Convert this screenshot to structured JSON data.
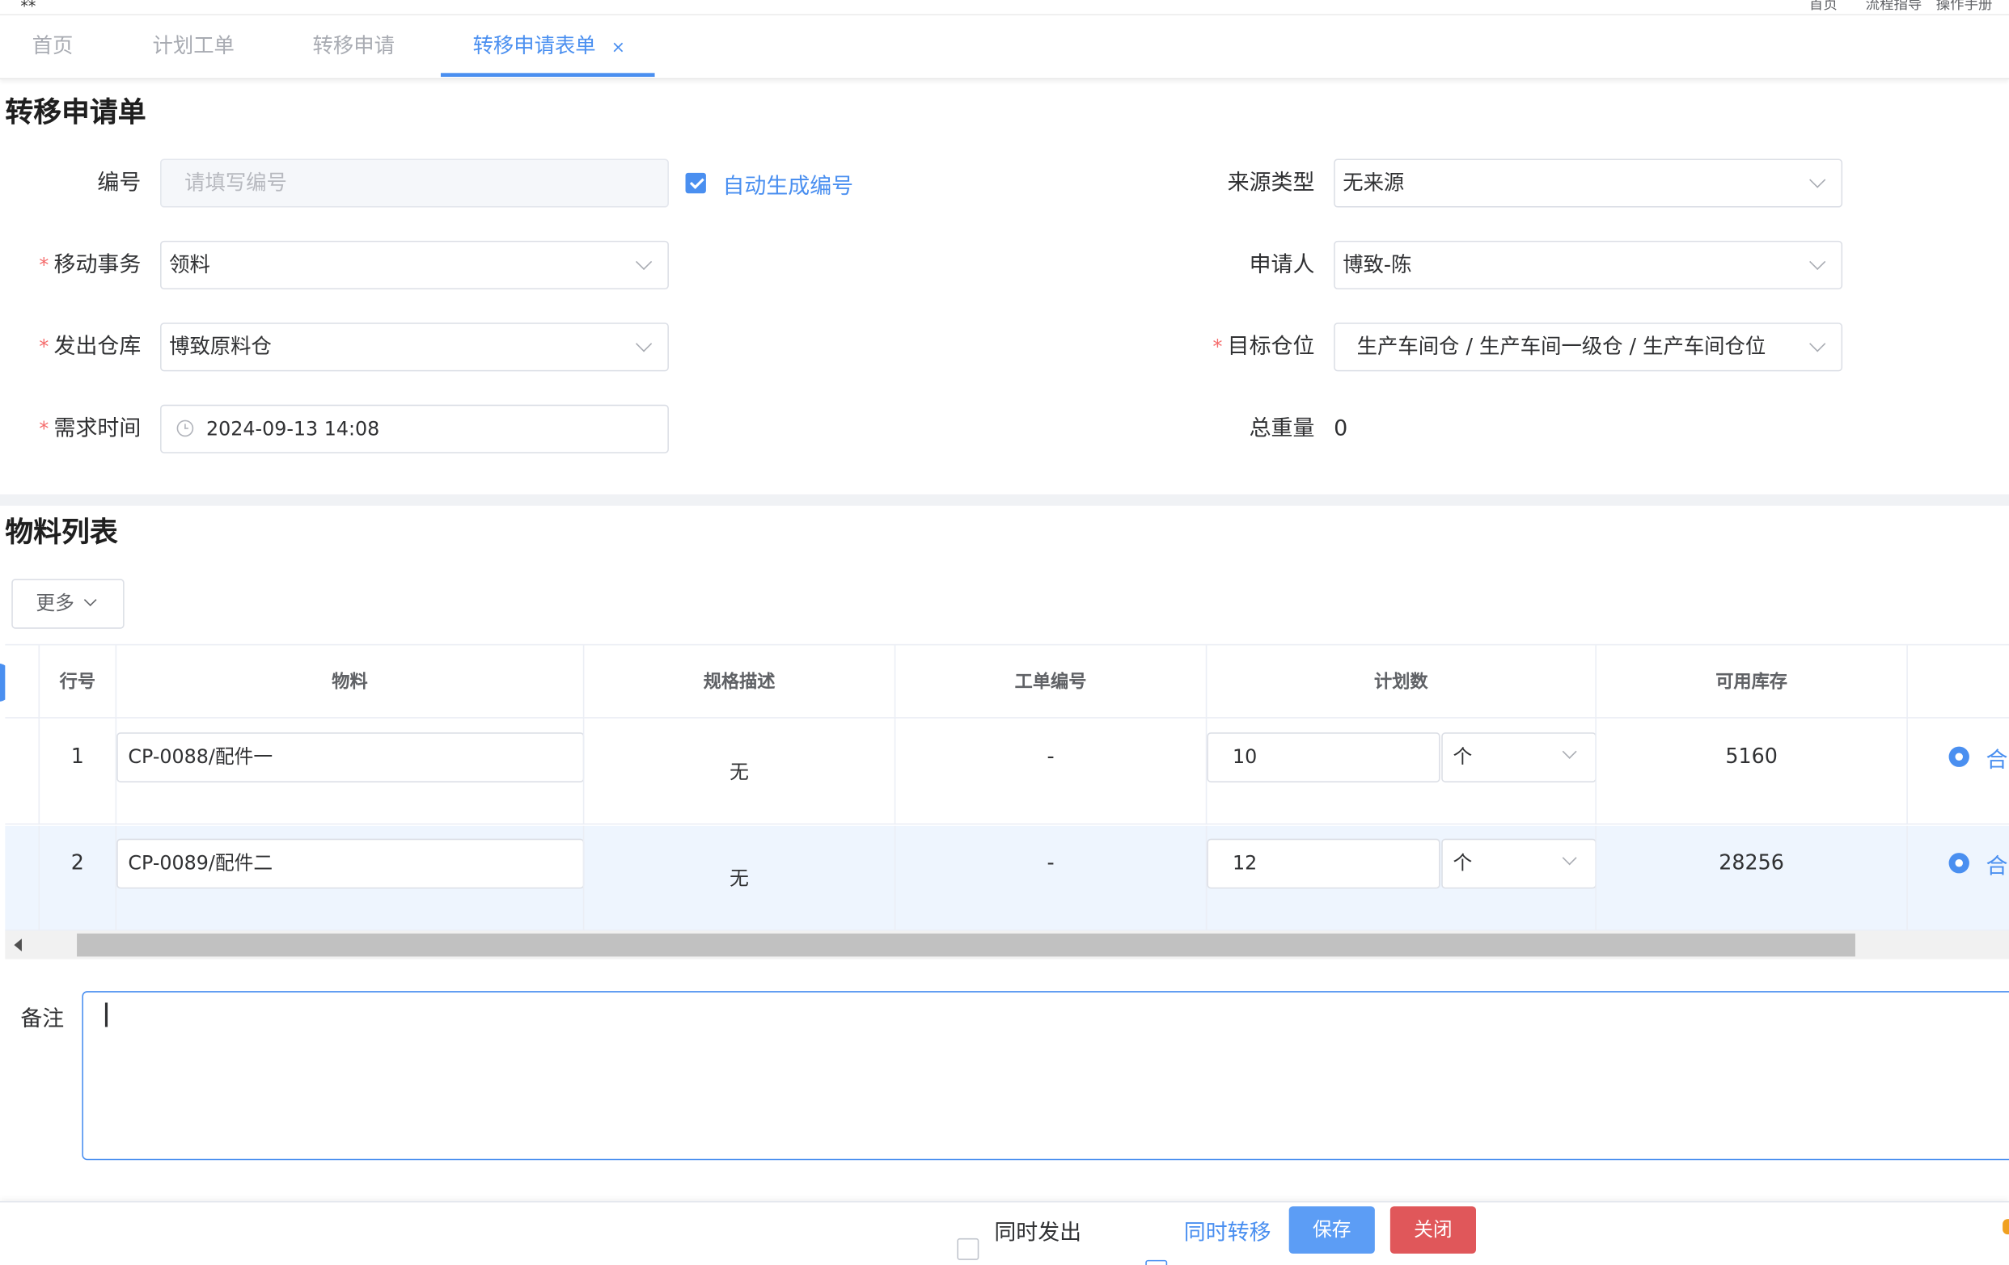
{
  "header": {
    "links": [
      "首页",
      "流程指导",
      "操作手册"
    ]
  },
  "tabs": [
    {
      "label": "首页",
      "active": false
    },
    {
      "label": "计划工单",
      "active": false
    },
    {
      "label": "转移申请",
      "active": false
    },
    {
      "label": "转移申请表单",
      "active": true
    }
  ],
  "tab_close_glyph": "×",
  "form": {
    "title": "转移申请单",
    "number": {
      "label": "编号",
      "placeholder": "请填写编号",
      "auto_label": "自动生成编号",
      "auto_checked": true
    },
    "source_type": {
      "label": "来源类型",
      "value": "无来源"
    },
    "move_action": {
      "label": "移动事务",
      "value": "领料",
      "required": true
    },
    "applicant": {
      "label": "申请人",
      "value": "博致-陈"
    },
    "from_warehouse": {
      "label": "发出仓库",
      "value": "博致原料仓",
      "required": true
    },
    "target_location": {
      "label": "目标仓位",
      "value": "生产车间仓 / 生产车间一级仓 / 生产车间仓位",
      "required": true
    },
    "demand_time": {
      "label": "需求时间",
      "value": "2024-09-13 14:08",
      "required": true
    },
    "total_weight": {
      "label": "总重量",
      "value": "0"
    },
    "required_mark": "*"
  },
  "materials": {
    "title": "物料列表",
    "more_button": "更多",
    "columns": [
      "行号",
      "物料",
      "规格描述",
      "工单编号",
      "计划数",
      "可用库存"
    ],
    "rows": [
      {
        "line": "1",
        "material": "CP-0088/配件一",
        "spec": "无",
        "work_order": "-",
        "plan_qty": "10",
        "unit": "个",
        "stock": "5160",
        "radio_label": "合"
      },
      {
        "line": "2",
        "material": "CP-0089/配件二",
        "spec": "无",
        "work_order": "-",
        "plan_qty": "12",
        "unit": "个",
        "stock": "28256",
        "radio_label": "合"
      }
    ]
  },
  "remark": {
    "label": "备注",
    "value": ""
  },
  "footer": {
    "issue_together": {
      "label": "同时发出",
      "checked": false
    },
    "transfer_together": {
      "label": "同时转移",
      "checked": true
    },
    "save": "保存",
    "close": "关闭"
  },
  "colors": {
    "primary": "#4a8ff0",
    "save_button": "#5c9df5",
    "close_button": "#e0575a",
    "required": "#f56c6c",
    "selected_row_bg": "#eef5fe"
  }
}
